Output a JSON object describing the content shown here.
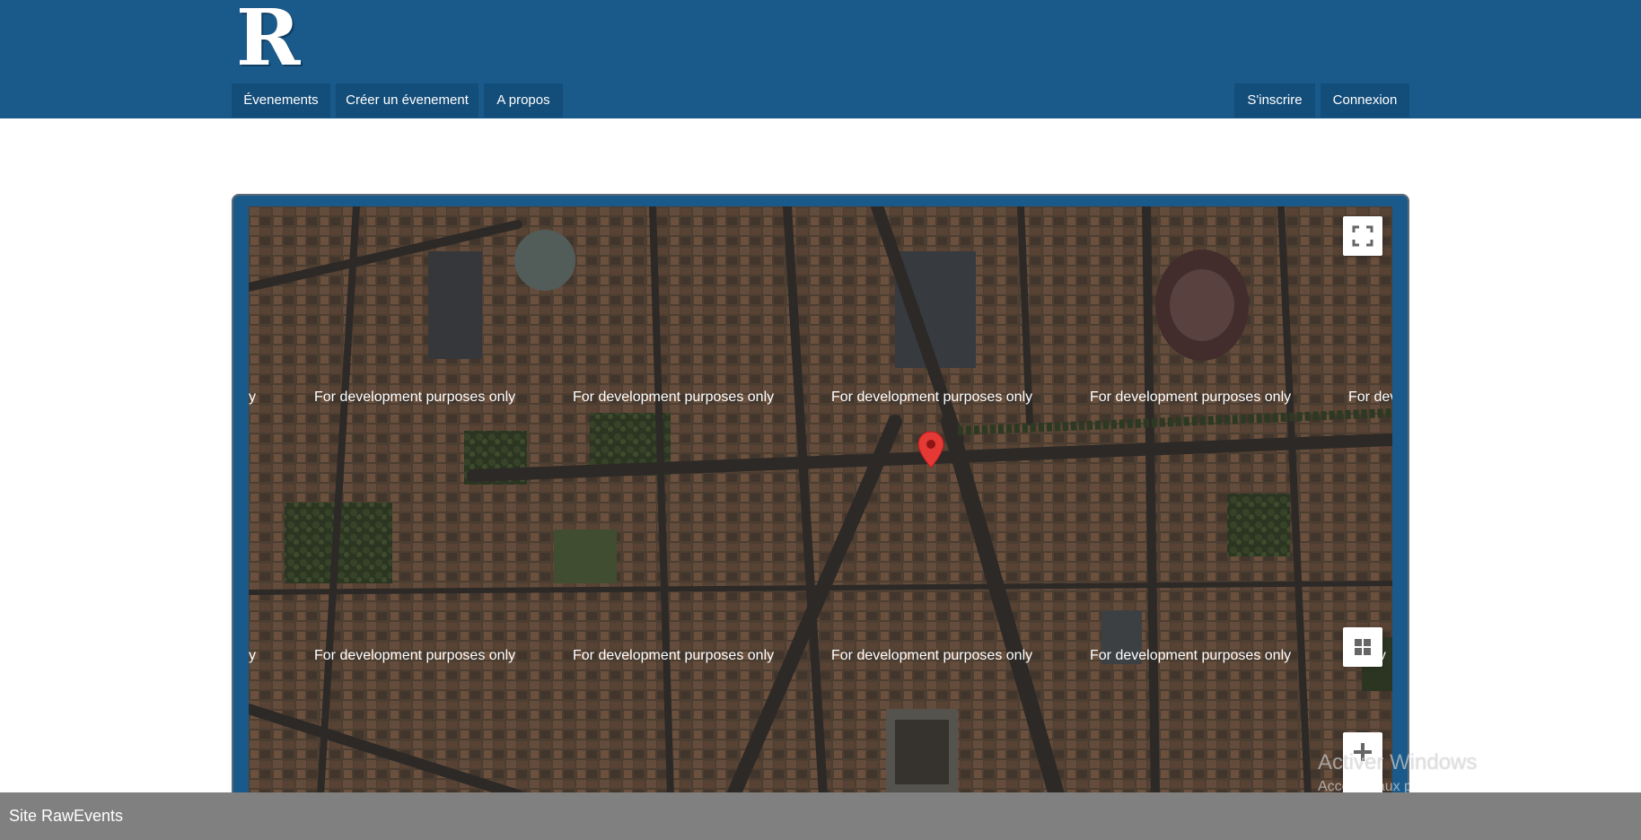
{
  "header": {
    "logo_letter": "R",
    "nav_left": [
      "Évenements",
      "Créer un évenement",
      "A propos"
    ],
    "nav_right": [
      "S'inscrire",
      "Connexion"
    ]
  },
  "map": {
    "watermark_text": "For development purposes only",
    "watermark_edge_left": "y",
    "watermark_edge_right_row1": "For dev",
    "watermark_edge_right_row2": "ev",
    "controls": [
      "fullscreen-icon",
      "map-type-icon",
      "zoom-in-icon"
    ],
    "marker_color": "#e53935"
  },
  "footer": {
    "text": "Site RawEvents"
  },
  "windows_activation": {
    "title": "Activer Windows",
    "subtitle": "Accédez aux paramètres pour activer Windows."
  },
  "colors": {
    "header_bg": "#1a5a8a",
    "nav_button_bg": "#134d79",
    "footer_bg": "#808080"
  }
}
